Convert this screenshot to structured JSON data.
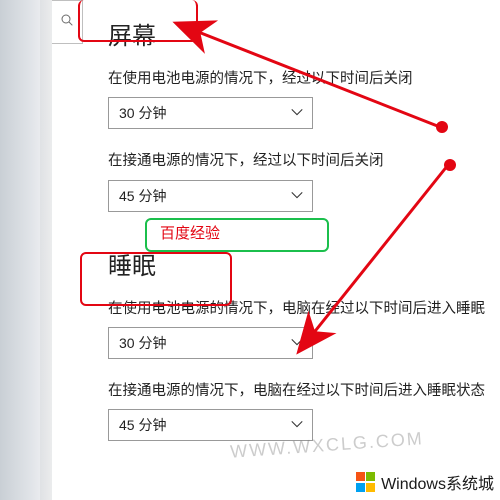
{
  "screen": {
    "title": "屏幕",
    "battery": {
      "label": "在使用电池电源的情况下，经过以下时间后关闭",
      "value": "30 分钟"
    },
    "plugged": {
      "label": "在接通电源的情况下，经过以下时间后关闭",
      "value": "45 分钟"
    }
  },
  "sleep": {
    "title": "睡眠",
    "battery": {
      "label": "在使用电池电源的情况下，电脑在经过以下时间后进入睡眠",
      "value": "30 分钟"
    },
    "plugged": {
      "label": "在接通电源的情况下，电脑在经过以下时间后进入睡眠状态",
      "value": "45 分钟"
    }
  },
  "annotations": {
    "green_label": "百度经验",
    "watermark": "WWW.WXCLG.COM",
    "logo_text": "Windows系统城",
    "red_boxes": [
      "屏幕",
      "睡眠"
    ],
    "arrow_color": "#e30613"
  }
}
